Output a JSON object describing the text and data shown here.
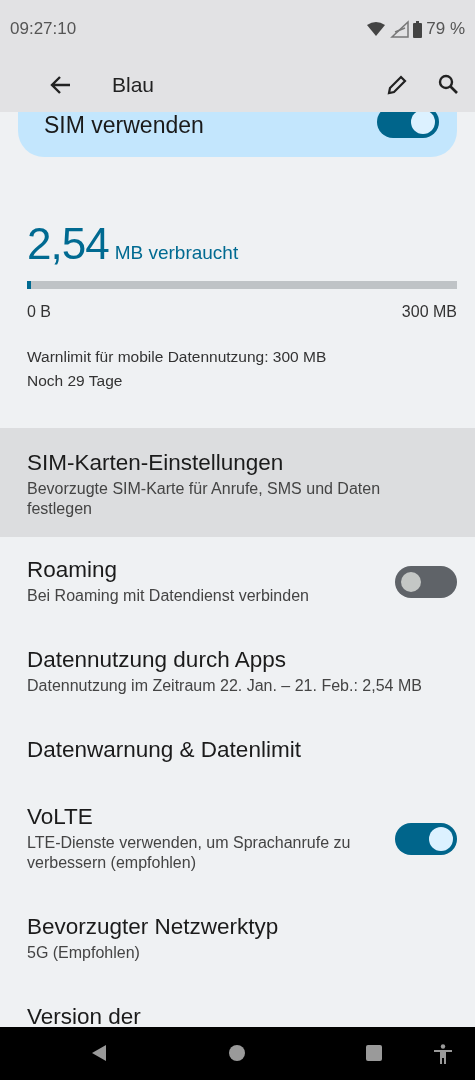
{
  "status_bar": {
    "time": "09:27:10",
    "battery": "79 %"
  },
  "app_bar": {
    "title": "Blau"
  },
  "sim_card": {
    "label": "SIM verwenden",
    "on": true
  },
  "usage": {
    "amount": "2,54",
    "unit": "MB verbraucht",
    "level": 0.0085,
    "min": "0 B",
    "max": "300 MB",
    "warning": "Warnlimit für mobile Datennutzung: 300 MB",
    "remaining": "Noch 29 Tage"
  },
  "rows": [
    {
      "kind": "plain",
      "title": "SIM-Karten-Einstellungen",
      "summary": "Bevorzugte SIM-Karte für Anrufe, SMS und Daten festlegen",
      "selected": true
    },
    {
      "kind": "switch",
      "title": "Roaming",
      "summary": "Bei Roaming mit Datendienst verbinden",
      "on": false,
      "selected": false
    },
    {
      "kind": "plain",
      "title": "Datennutzung durch Apps",
      "summary": "Datennutzung im Zeitraum 22. Jan. – 21. Feb.: 2,54 MB",
      "selected": false
    },
    {
      "kind": "plain",
      "title": "Datenwarnung & Datenlimit",
      "selected": false
    },
    {
      "kind": "switch",
      "title": "VoLTE",
      "summary": "LTE-Dienste verwenden, um Sprachanrufe zu verbessern (empfohlen)",
      "on": true,
      "selected": false
    },
    {
      "kind": "plain",
      "title": "Bevorzugter Netzwerktyp",
      "summary": "5G (Empfohlen)",
      "selected": false
    },
    {
      "kind": "plain",
      "title": "Version der",
      "selected": false
    }
  ]
}
